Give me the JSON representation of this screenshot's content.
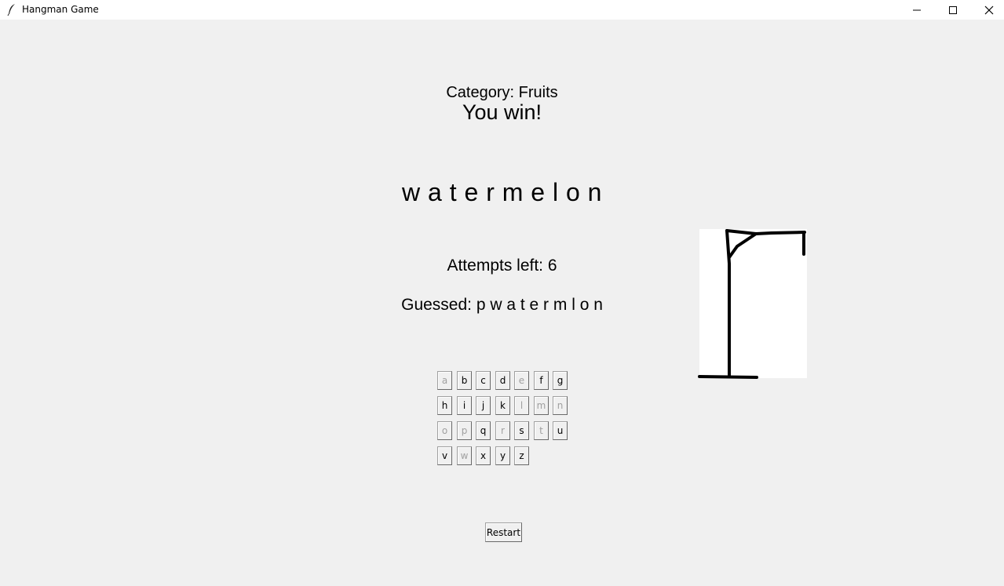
{
  "window": {
    "title": "Hangman Game",
    "icon": "feather-icon",
    "controls": [
      "minimize-icon",
      "maximize-icon",
      "close-icon"
    ]
  },
  "game": {
    "category": "Category: Fruits",
    "status": "You win!",
    "word_display": "w a t e r m e l o n",
    "attempts": "Attempts left: 6",
    "guessed": "Guessed: p w a t e r m l o n"
  },
  "keyboard": {
    "rows": [
      [
        {
          "label": "a",
          "used": true
        },
        {
          "label": "b",
          "used": false
        },
        {
          "label": "c",
          "used": false
        },
        {
          "label": "d",
          "used": false
        },
        {
          "label": "e",
          "used": true
        },
        {
          "label": "f",
          "used": false
        },
        {
          "label": "g",
          "used": false
        }
      ],
      [
        {
          "label": "h",
          "used": false
        },
        {
          "label": "i",
          "used": false
        },
        {
          "label": "j",
          "used": false
        },
        {
          "label": "k",
          "used": false
        },
        {
          "label": "l",
          "used": true
        },
        {
          "label": "m",
          "used": true
        },
        {
          "label": "n",
          "used": true
        }
      ],
      [
        {
          "label": "o",
          "used": true
        },
        {
          "label": "p",
          "used": true
        },
        {
          "label": "q",
          "used": false
        },
        {
          "label": "r",
          "used": true
        },
        {
          "label": "s",
          "used": false
        },
        {
          "label": "t",
          "used": true
        },
        {
          "label": "u",
          "used": false
        }
      ],
      [
        {
          "label": "v",
          "used": false
        },
        {
          "label": "w",
          "used": true
        },
        {
          "label": "x",
          "used": false
        },
        {
          "label": "y",
          "used": false
        },
        {
          "label": "z",
          "used": false
        }
      ]
    ]
  },
  "controls": {
    "restart_label": "Restart"
  },
  "colors": {
    "background": "#f0f0f0",
    "disabled_text": "#a0a0a0",
    "drawing_stroke": "#000000"
  }
}
